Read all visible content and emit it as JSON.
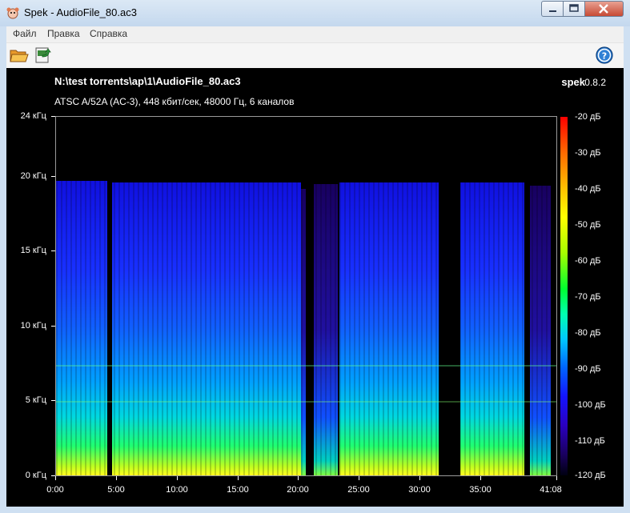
{
  "window": {
    "title": "Spek - AudioFile_80.ac3",
    "app_icon": "spek-app-icon",
    "controls": [
      "minimize-icon",
      "maximize-icon",
      "close-icon"
    ]
  },
  "menu": {
    "items": [
      "Файл",
      "Правка",
      "Справка"
    ]
  },
  "toolbar": {
    "open_icon": "folder-open-icon",
    "save_icon": "save-export-icon",
    "help_icon": "help-icon"
  },
  "spectrogram": {
    "file_path": "N:\\test torrents\\ap\\1\\AudioFile_80.ac3",
    "stream_info": "ATSC A/52A (AC-3), 448 кбит/сек, 48000 Гц, 6 каналов",
    "app_name": "spek",
    "app_version": "0.8.2",
    "frequency_ticks": [
      "24 кГц",
      "20 кГц",
      "15 кГц",
      "10 кГц",
      "5 кГц",
      "0 кГц"
    ],
    "time_ticks": [
      "0:00",
      "5:00",
      "10:00",
      "15:00",
      "20:00",
      "25:00",
      "30:00",
      "35:00",
      "41:08"
    ],
    "db_ticks": [
      "-20 дБ",
      "-30 дБ",
      "-40 дБ",
      "-50 дБ",
      "-60 дБ",
      "-70 дБ",
      "-80 дБ",
      "-90 дБ",
      "-100 дБ",
      "-110 дБ",
      "-120 дБ"
    ],
    "colors": {
      "background": "#000000",
      "low": "#1a0060",
      "mid": "#0064ff",
      "high": "#ffff00",
      "peak": "#ff0000"
    }
  }
}
